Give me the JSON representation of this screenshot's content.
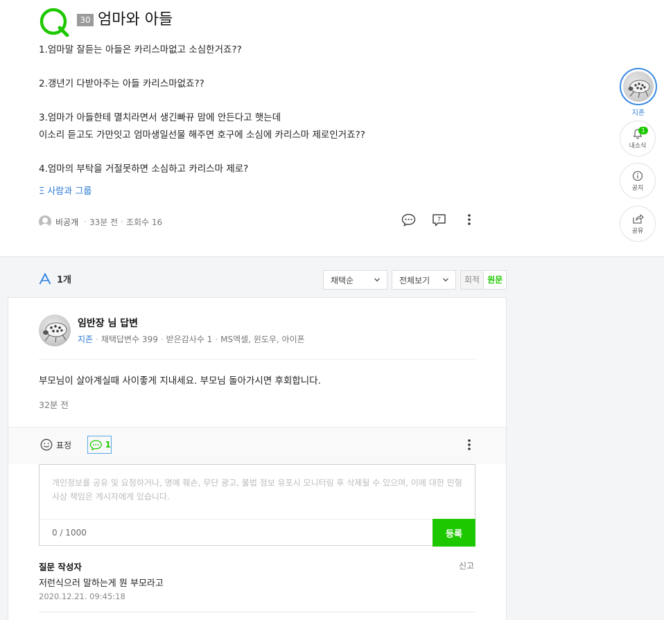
{
  "question": {
    "badge": "30",
    "title": "엄마와 아들",
    "lines": [
      "1.엄마말 잘듣는 아들은 카리스마없고 소심한거죠??",
      "",
      "2.갱년기 다받아주는 아들 카리스마없죠??",
      "",
      "3.엄마가 아들한테 멸치라면서 생긴빠뀨 맘에 안든다고 햇는데",
      "이소리 듣고도 가만잇고 엄마생일선물 해주면 호구에 소심에 카리스마 제로인거죠??",
      "",
      "4.엄마의 부탁을 거절못하면 소심하고 카리스마 제로?"
    ],
    "tag": "Ξ 사람과 그룹",
    "author": "비공개",
    "time": "33분 전",
    "views": "조회수 16"
  },
  "side": {
    "profile_name": "지존",
    "notice_count": "1",
    "notice_label": "내소식",
    "info_label": "공지",
    "share_label": "공유"
  },
  "answers": {
    "count_label": "1개",
    "sort_label": "채택순",
    "filter_label": "전체보기",
    "toggle_off": "회적",
    "toggle_on": "원문"
  },
  "answer": {
    "name": "임반장 님 답변",
    "grade": "지존",
    "adopted": "채택답변수 399",
    "thanks": "받은감사수 1",
    "field": "MS엑셀, 윈도우, 아이폰",
    "text": "부모님이 살아계실때 사이좋게 지내세요. 부모님 돌아가시면 후회합니다.",
    "time": "32분 전"
  },
  "comments": {
    "emoji_label": "표정",
    "count": "1",
    "placeholder": "개인정보를 공유 및 요청하거나, 명예 훼손, 무단 광고, 불법 정보 유포시 모니터링 후 삭제될 수 있으며, 이에 대한 민형사상 책임은 게시자에게 있습니다.",
    "char_count": "0 / 1000",
    "submit": "등록",
    "list": [
      {
        "writer": "질문 작성자",
        "report": "신고",
        "text": "저런식으러 말하는게 뭔 부모라고",
        "date": "2020.12.21. 09:45:18"
      }
    ]
  },
  "colors": {
    "accent_green": "#1ec800",
    "link_blue": "#2b79d6"
  }
}
